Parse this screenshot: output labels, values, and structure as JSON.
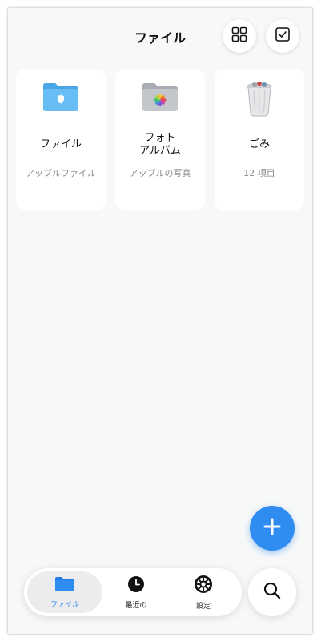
{
  "header": {
    "title": "ファイル",
    "grid_icon": "grid-view-icon",
    "select_icon": "checkbox-select-icon"
  },
  "cards": [
    {
      "name": "ファイル",
      "subtitle": "アップルファイル",
      "icon": "blue-apple-folder-icon"
    },
    {
      "name": "フォト\nアルバム",
      "subtitle": "アップルの写真",
      "icon": "photos-folder-icon"
    },
    {
      "name": "ごみ",
      "subtitle": "12 項目",
      "icon": "trash-can-icon"
    }
  ],
  "fab": {
    "icon": "plus-icon"
  },
  "tabs": [
    {
      "label": "ファイル",
      "icon": "folder-icon",
      "active": true
    },
    {
      "label": "最近の",
      "icon": "clock-icon",
      "active": false
    },
    {
      "label": "設定",
      "icon": "gear-icon",
      "active": false
    }
  ],
  "search": {
    "icon": "search-icon"
  },
  "colors": {
    "accent": "#2f8cf0",
    "background": "#f7f8f8",
    "folder_blue": "#5ab3ee"
  }
}
